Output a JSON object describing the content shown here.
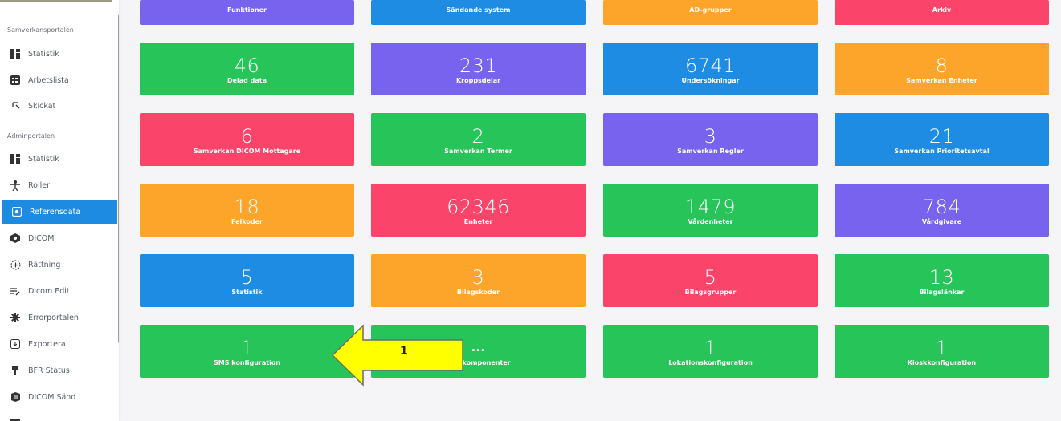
{
  "sidebar": {
    "sections": [
      {
        "title": "Samverkansportalen"
      },
      {
        "title": "Adminportalen"
      }
    ],
    "items": [
      {
        "label": "Statistik",
        "icon": "dashboard-icon"
      },
      {
        "label": "Arbetslista",
        "icon": "list-icon"
      },
      {
        "label": "Skickat",
        "icon": "send-icon"
      },
      {
        "label": "Statistik",
        "icon": "dashboard-icon"
      },
      {
        "label": "Roller",
        "icon": "person-icon"
      },
      {
        "label": "Referensdata",
        "icon": "reference-icon",
        "active": true
      },
      {
        "label": "DICOM",
        "icon": "dicom-icon"
      },
      {
        "label": "Rättning",
        "icon": "correction-icon"
      },
      {
        "label": "Dicom Edit",
        "icon": "edit-list-icon"
      },
      {
        "label": "Errorportalen",
        "icon": "error-icon"
      },
      {
        "label": "Exportera",
        "icon": "export-icon"
      },
      {
        "label": "BFR Status",
        "icon": "status-icon"
      },
      {
        "label": "DICOM Sänd",
        "icon": "dicom-send-icon"
      }
    ]
  },
  "cards_top_partial": [
    {
      "label": "Funktioner",
      "color": "#7863ee"
    },
    {
      "label": "Sändande system",
      "color": "#1f8ce4"
    },
    {
      "label": "AD-grupper",
      "color": "#fda52a"
    },
    {
      "label": "Arkiv",
      "color": "#fb4469"
    }
  ],
  "cards": [
    {
      "value": "46",
      "label": "Delad data",
      "color": "green"
    },
    {
      "value": "231",
      "label": "Kroppsdelar",
      "color": "purple"
    },
    {
      "value": "6741",
      "label": "Undersökningar",
      "color": "blue"
    },
    {
      "value": "8",
      "label": "Samverkan Enheter",
      "color": "orange"
    },
    {
      "value": "6",
      "label": "Samverkan DICOM Mottagare",
      "color": "red"
    },
    {
      "value": "2",
      "label": "Samverkan Termer",
      "color": "green"
    },
    {
      "value": "3",
      "label": "Samverkan Regler",
      "color": "purple"
    },
    {
      "value": "21",
      "label": "Samverkan Prioritetsavtal",
      "color": "blue"
    },
    {
      "value": "18",
      "label": "Felkoder",
      "color": "orange"
    },
    {
      "value": "62346",
      "label": "Enheter",
      "color": "red"
    },
    {
      "value": "1479",
      "label": "Vårdenheter",
      "color": "green"
    },
    {
      "value": "784",
      "label": "Vårdgivare",
      "color": "purple"
    },
    {
      "value": "5",
      "label": "Statistik",
      "color": "blue"
    },
    {
      "value": "3",
      "label": "Bilagskoder",
      "color": "orange"
    },
    {
      "value": "5",
      "label": "Bilagsgrupper",
      "color": "red"
    },
    {
      "value": "13",
      "label": "Bilagslänkar",
      "color": "green"
    },
    {
      "value": "1",
      "label": "SMS konfiguration",
      "color": "green"
    },
    {
      "value": "...",
      "label": "...nekomponenter",
      "color": "green"
    },
    {
      "value": "1",
      "label": "Lokationskonfiguration",
      "color": "green"
    },
    {
      "value": "1",
      "label": "Kioskkonfiguration",
      "color": "green"
    }
  ],
  "annotation": {
    "label": "1",
    "color": "#ffff00"
  }
}
